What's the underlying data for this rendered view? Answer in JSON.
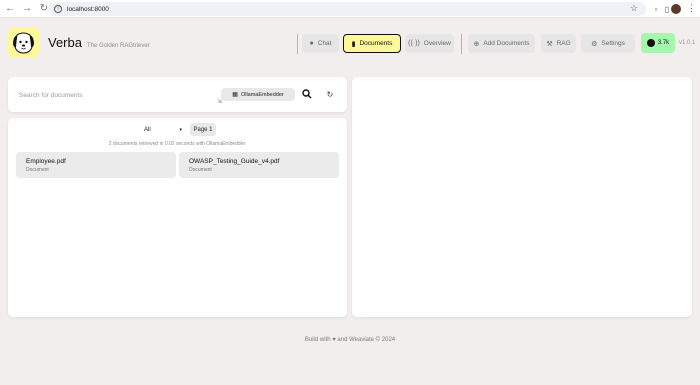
{
  "browser": {
    "url": "localhost:8000",
    "icons": [
      "back-icon",
      "forward-icon",
      "reload-icon",
      "info-icon",
      "star-icon",
      "extensions-icon",
      "sidebar-icon",
      "profile-avatar",
      "more-icon"
    ]
  },
  "header": {
    "title": "Verba",
    "tagline": "The Golden RAGtriever",
    "nav": {
      "chat": "Chat",
      "documents": "Documents",
      "overview": "Overview",
      "add_documents": "Add Documents",
      "rag": "RAG",
      "settings": "Settings"
    },
    "github_stars": "3.7k",
    "version": "v1.0.1"
  },
  "search": {
    "placeholder": "Search for documents",
    "embedder": "OllamaEmbedder"
  },
  "documents": {
    "filter": "All",
    "page": "Page 1",
    "retrieved_text": "2 documents retrieved in 0.02 seconds with OllamaEmbedder.",
    "items": [
      {
        "name": "Employee.pdf",
        "type": "Document"
      },
      {
        "name": "OWASP_Testing_Guide_v4.pdf",
        "type": "Document"
      }
    ]
  },
  "footer": {
    "text": "Build with ♥ and Weaviate © 2024"
  },
  "colors": {
    "accent": "#fdf99a",
    "github": "#a4f7ad",
    "background": "#f3eeee"
  }
}
